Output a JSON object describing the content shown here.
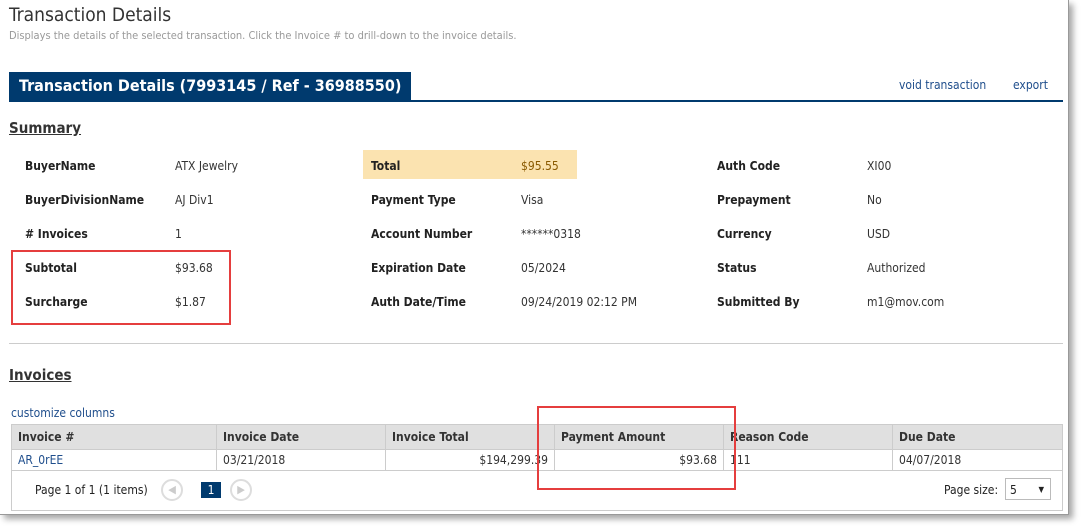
{
  "header": {
    "title": "Transaction Details",
    "subtitle": "Displays the details of the selected transaction. Click the Invoice # to drill-down to the invoice details."
  },
  "panel": {
    "title": "Transaction Details (7993145 / Ref - 36988550)",
    "void_label": "void transaction",
    "export_label": "export"
  },
  "summary": {
    "heading": "Summary",
    "col1": [
      {
        "label": "BuyerName",
        "value": "ATX Jewelry"
      },
      {
        "label": "BuyerDivisionName",
        "value": "AJ Div1"
      },
      {
        "label": "# Invoices",
        "value": "1"
      },
      {
        "label": "Subtotal",
        "value": "$93.68"
      },
      {
        "label": "Surcharge",
        "value": "$1.87"
      }
    ],
    "col2": [
      {
        "label": "Total",
        "value": "$95.55"
      },
      {
        "label": "Payment Type",
        "value": "Visa"
      },
      {
        "label": "Account Number",
        "value": "******0318"
      },
      {
        "label": "Expiration Date",
        "value": "05/2024"
      },
      {
        "label": "Auth Date/Time",
        "value": "09/24/2019 02:12 PM"
      }
    ],
    "col3": [
      {
        "label": "Auth Code",
        "value": "XI00"
      },
      {
        "label": "Prepayment",
        "value": "No"
      },
      {
        "label": "Currency",
        "value": "USD"
      },
      {
        "label": "Status",
        "value": "Authorized"
      },
      {
        "label": "Submitted By",
        "value": "m1@mov.com"
      }
    ]
  },
  "invoices": {
    "heading": "Invoices",
    "customize_label": "customize columns",
    "columns": [
      "Invoice #",
      "Invoice Date",
      "Invoice Total",
      "Payment Amount",
      "Reason Code",
      "Due Date"
    ],
    "rows": [
      [
        "AR_0rEE",
        "03/21/2018",
        "$194,299.39",
        "$93.68",
        "111",
        "04/07/2018"
      ]
    ],
    "pager": {
      "info": "Page 1 of 1 (1 items)",
      "current": "1",
      "page_size_label": "Page size:",
      "page_size": "5"
    }
  },
  "colors": {
    "accent": "#003a6e",
    "highlight": "#fbe3b0",
    "annotation": "#e53e3e",
    "link": "#1f4e8c"
  }
}
